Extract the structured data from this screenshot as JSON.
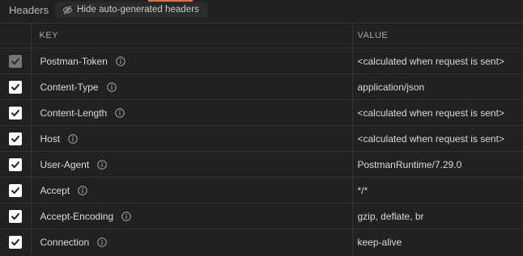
{
  "tabbar": {
    "title": "Headers",
    "hide_button_label": "Hide auto-generated headers",
    "hide_button_icon": "eye-slash-icon",
    "accent_color": "#ff6c37"
  },
  "table": {
    "columns": [
      "KEY",
      "VALUE"
    ],
    "rows": [
      {
        "key": "Postman-Token",
        "value": "<calculated when request is sent>",
        "checked": true,
        "disabled": true
      },
      {
        "key": "Content-Type",
        "value": "application/json",
        "checked": true,
        "disabled": false
      },
      {
        "key": "Content-Length",
        "value": "<calculated when request is sent>",
        "checked": true,
        "disabled": false
      },
      {
        "key": "Host",
        "value": "<calculated when request is sent>",
        "checked": true,
        "disabled": false
      },
      {
        "key": "User-Agent",
        "value": "PostmanRuntime/7.29.0",
        "checked": true,
        "disabled": false
      },
      {
        "key": "Accept",
        "value": "*/*",
        "checked": true,
        "disabled": false
      },
      {
        "key": "Accept-Encoding",
        "value": "gzip, deflate, br",
        "checked": true,
        "disabled": false
      },
      {
        "key": "Connection",
        "value": "keep-alive",
        "checked": true,
        "disabled": false
      }
    ]
  }
}
